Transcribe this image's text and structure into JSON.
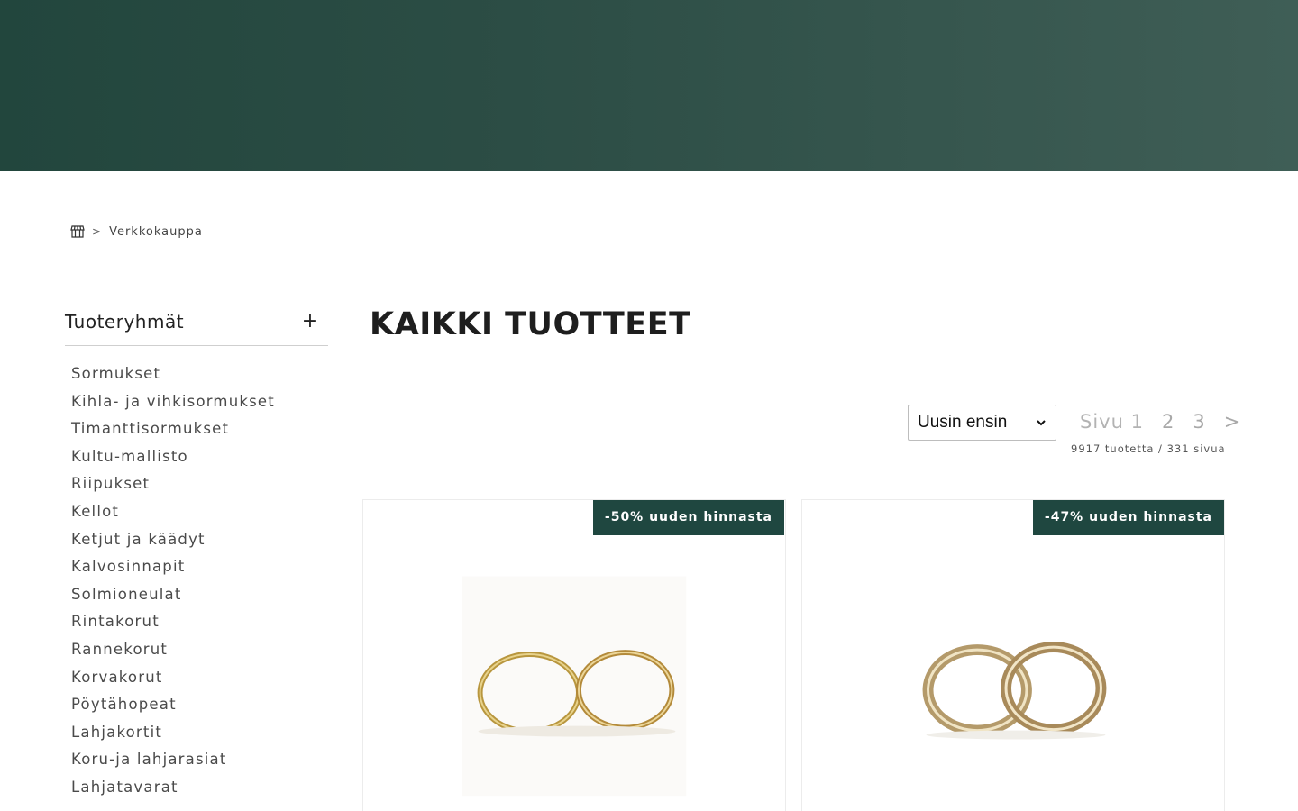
{
  "breadcrumb": {
    "home_icon": "store-icon",
    "separator": ">",
    "current": "Verkkokauppa"
  },
  "sidebar": {
    "title": "Tuoteryhmät",
    "toggle": "+",
    "categories": [
      "Sormukset",
      "Kihla- ja vihkisormukset",
      "Timanttisormukset",
      "Kultu-mallisto",
      "Riipukset",
      "Kellot",
      "Ketjut ja käädyt",
      "Kalvosinnapit",
      "Solmioneulat",
      "Rintakorut",
      "Rannekorut",
      "Korvakorut",
      "Pöytähopeat",
      "Lahjakortit",
      "Koru-ja lahjarasiat",
      "Lahjatavarat"
    ]
  },
  "main": {
    "title": "KAIKKI TUOTTEET",
    "sort": {
      "selected": "Uusin ensin"
    },
    "pagination": {
      "label": "Sivu",
      "current": "1",
      "pages": [
        "2",
        "3"
      ],
      "next": ">",
      "summary": "9917 tuotetta / 331 sivua"
    },
    "products": [
      {
        "badge": "-50% uuden hinnasta"
      },
      {
        "badge": "-47% uuden hinnasta"
      }
    ]
  },
  "colors": {
    "hero_start": "#22463d",
    "hero_end": "#3f5e56",
    "badge_bg": "#1f4740"
  }
}
